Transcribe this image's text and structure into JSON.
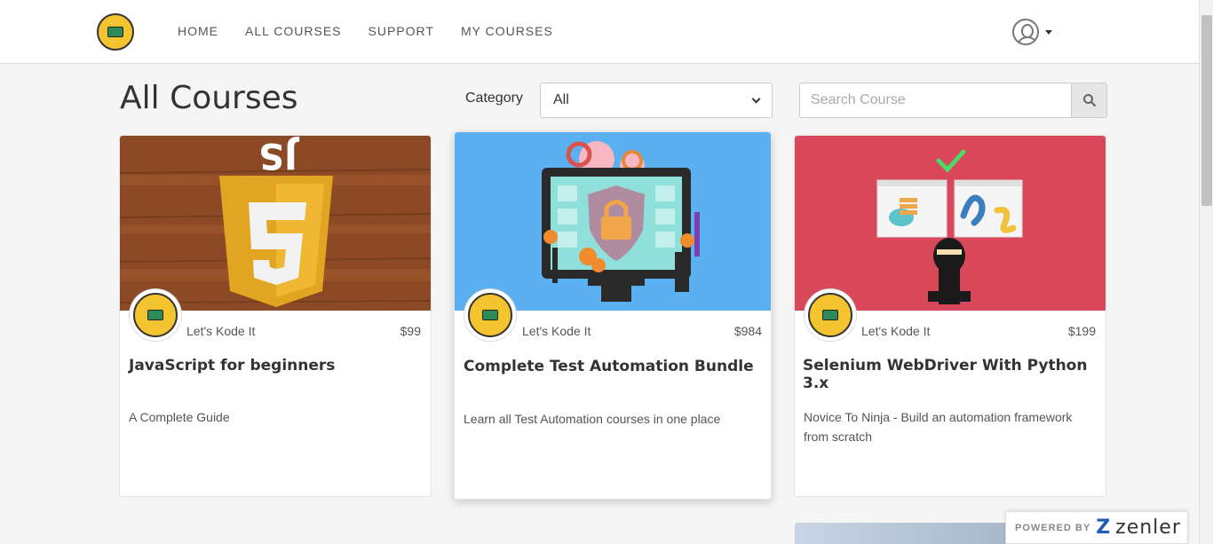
{
  "nav": {
    "items": [
      "HOME",
      "ALL COURSES",
      "SUPPORT",
      "MY COURSES"
    ]
  },
  "page": {
    "title": "All Courses",
    "category_label": "Category",
    "category_value": "All",
    "search_placeholder": "Search Course"
  },
  "courses": [
    {
      "author": "Let's Kode It",
      "price": "$99",
      "title": "JavaScript for beginners",
      "description": "A Complete Guide"
    },
    {
      "author": "Let's Kode It",
      "price": "$984",
      "title": "Complete Test Automation Bundle",
      "description": "Learn all Test Automation courses in one place"
    },
    {
      "author": "Let's Kode It",
      "price": "$199",
      "title": "Selenium WebDriver With Python 3.x",
      "description": "Novice To Ninja - Build an automation framework from scratch"
    }
  ],
  "footer": {
    "powered_by": "POWERED BY",
    "brand": "zenler"
  },
  "icons": {
    "logo": "lets-kode-it-logo",
    "user": "user-avatar-icon",
    "search": "search-icon"
  },
  "colors": {
    "js_thumb": "#8b4a25",
    "automation_thumb": "#5ab0f0",
    "selenium_thumb": "#d9475a",
    "brand_blue": "#1e5bb8"
  }
}
